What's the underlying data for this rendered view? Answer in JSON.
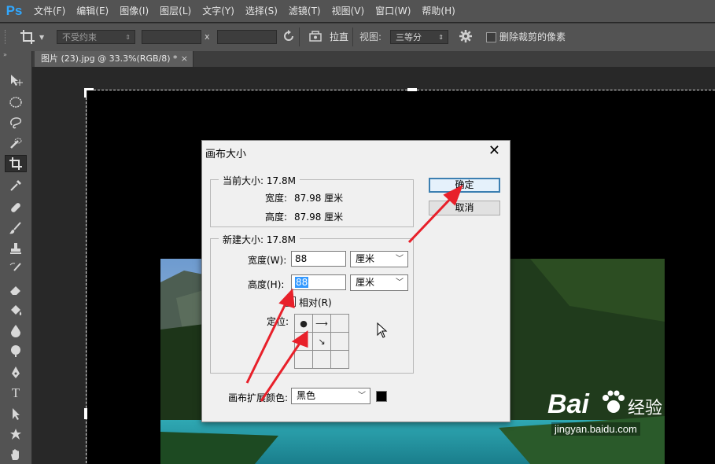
{
  "app": {
    "logo": "Ps"
  },
  "menu": [
    "文件(F)",
    "编辑(E)",
    "图像(I)",
    "图层(L)",
    "文字(Y)",
    "选择(S)",
    "滤镜(T)",
    "视图(V)",
    "窗口(W)",
    "帮助(H)"
  ],
  "options": {
    "constraint": "不受约束",
    "separator": "x",
    "straighten": "拉直",
    "view_label": "视图:",
    "view_value": "三等分",
    "delete_cropped": "删除裁剪的像素"
  },
  "tab": {
    "title": "图片 (23).jpg @ 33.3%(RGB/8) *",
    "close": "×"
  },
  "dialog": {
    "title": "画布大小",
    "current": {
      "label": "当前大小: 17.8M",
      "width_label": "宽度:",
      "width_value": "87.98 厘米",
      "height_label": "高度:",
      "height_value": "87.98 厘米"
    },
    "new": {
      "label": "新建大小: 17.8M",
      "width_label": "宽度(W):",
      "width_value": "88",
      "width_unit": "厘米",
      "height_label": "高度(H):",
      "height_value": "88",
      "height_unit": "厘米",
      "relative_label": "相对(R)",
      "anchor_label": "定位:"
    },
    "ext_color_label": "画布扩展颜色:",
    "ext_color_value": "黑色",
    "ok": "确定",
    "cancel": "取消"
  },
  "watermark": {
    "brand": "Bai",
    "brand2": "经验",
    "url": "jingyan.baidu.com"
  },
  "colors": {
    "arrow": "#e8202a",
    "ps_blue": "#31a8ff",
    "default_btn": "#3c7fb1"
  }
}
